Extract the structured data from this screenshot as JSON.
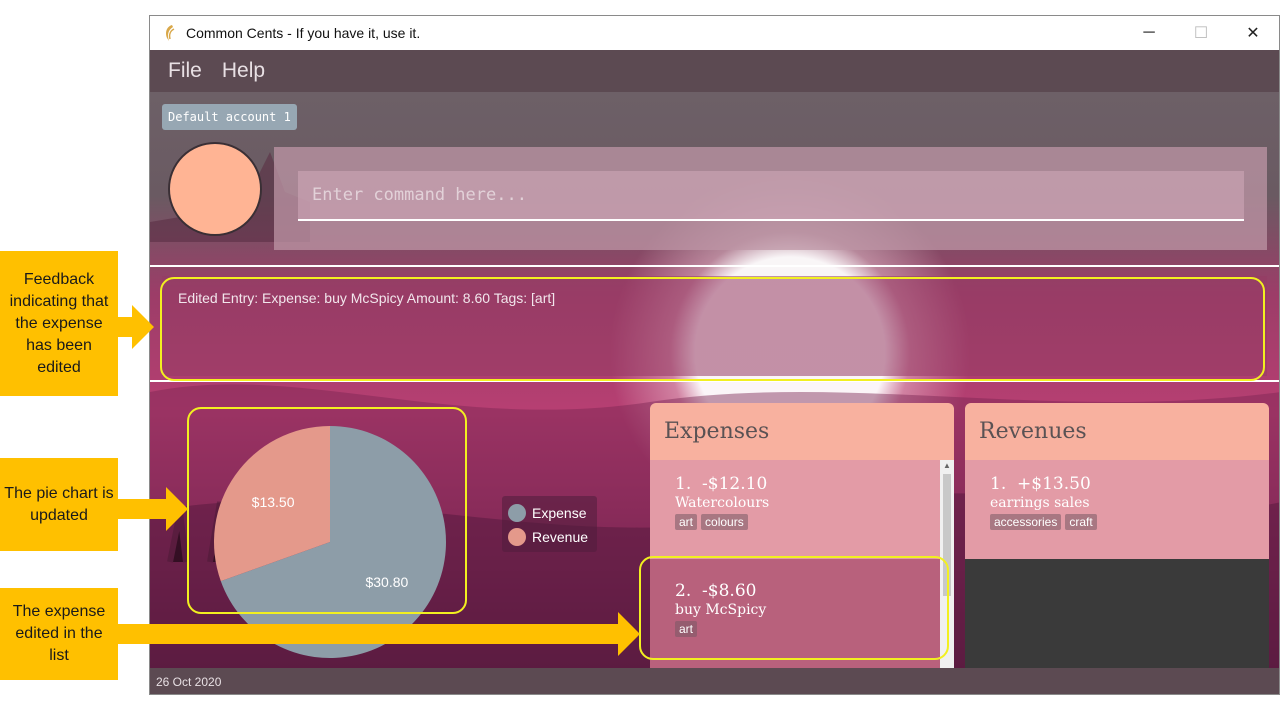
{
  "window": {
    "title": "Common Cents - If you have it, use it.",
    "controls": {
      "minimize": "─",
      "maximize": "☐",
      "close": "✕"
    }
  },
  "menu": {
    "items": [
      "File",
      "Help"
    ]
  },
  "account": {
    "name": "Default account 1"
  },
  "command": {
    "placeholder": "Enter command here...",
    "value": ""
  },
  "feedback": {
    "text": "Edited Entry: Expense: buy McSpicy Amount: 8.60 Tags: [art]"
  },
  "chart_data": {
    "type": "pie",
    "slices": [
      {
        "name": "Expense",
        "value": 30.8,
        "label": "$30.80",
        "color": "#8d9da8"
      },
      {
        "name": "Revenue",
        "value": 13.5,
        "label": "$13.50",
        "color": "#e4998b"
      }
    ],
    "legend": [
      "Expense",
      "Revenue"
    ],
    "legend_placement": "right"
  },
  "expenses": {
    "title": "Expenses",
    "entries": [
      {
        "index": "1.",
        "amount": "-$12.10",
        "description": "Watercolours",
        "tags": [
          "art",
          "colours"
        ]
      },
      {
        "index": "2.",
        "amount": "-$8.60",
        "description": "buy McSpicy",
        "tags": [
          "art"
        ]
      }
    ]
  },
  "revenues": {
    "title": "Revenues",
    "entries": [
      {
        "index": "1.",
        "amount": "+$13.50",
        "description": "earrings sales",
        "tags": [
          "accessories",
          "craft"
        ]
      }
    ]
  },
  "status": {
    "date": "26 Oct 2020"
  },
  "callouts": {
    "feedback": "Feedback indicating that the expense has been edited",
    "pie": "The pie chart is updated",
    "list": "The expense edited in the list"
  },
  "colors": {
    "callout": "#FFC000",
    "highlight": "#f2f020",
    "panel_header": "#F8B19F",
    "avatar": "#FFB494"
  }
}
